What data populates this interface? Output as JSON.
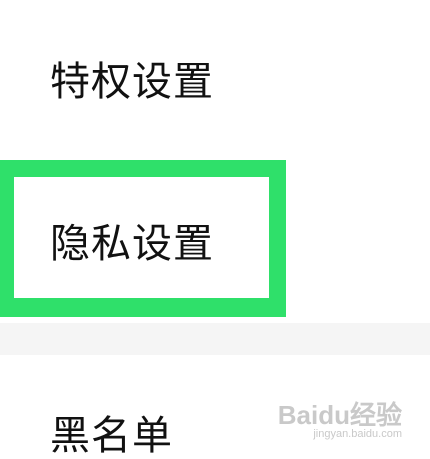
{
  "settings_list": {
    "items": [
      {
        "label": "特权设置"
      },
      {
        "label": "隐私设置"
      },
      {
        "label": "黑名单"
      }
    ],
    "highlighted_index": 1
  },
  "colors": {
    "highlight_frame": "#2fe06a",
    "divider": "#f5f5f5",
    "text": "#111111"
  },
  "watermark": {
    "main": "Baidu经验",
    "sub": "jingyan.baidu.com"
  }
}
